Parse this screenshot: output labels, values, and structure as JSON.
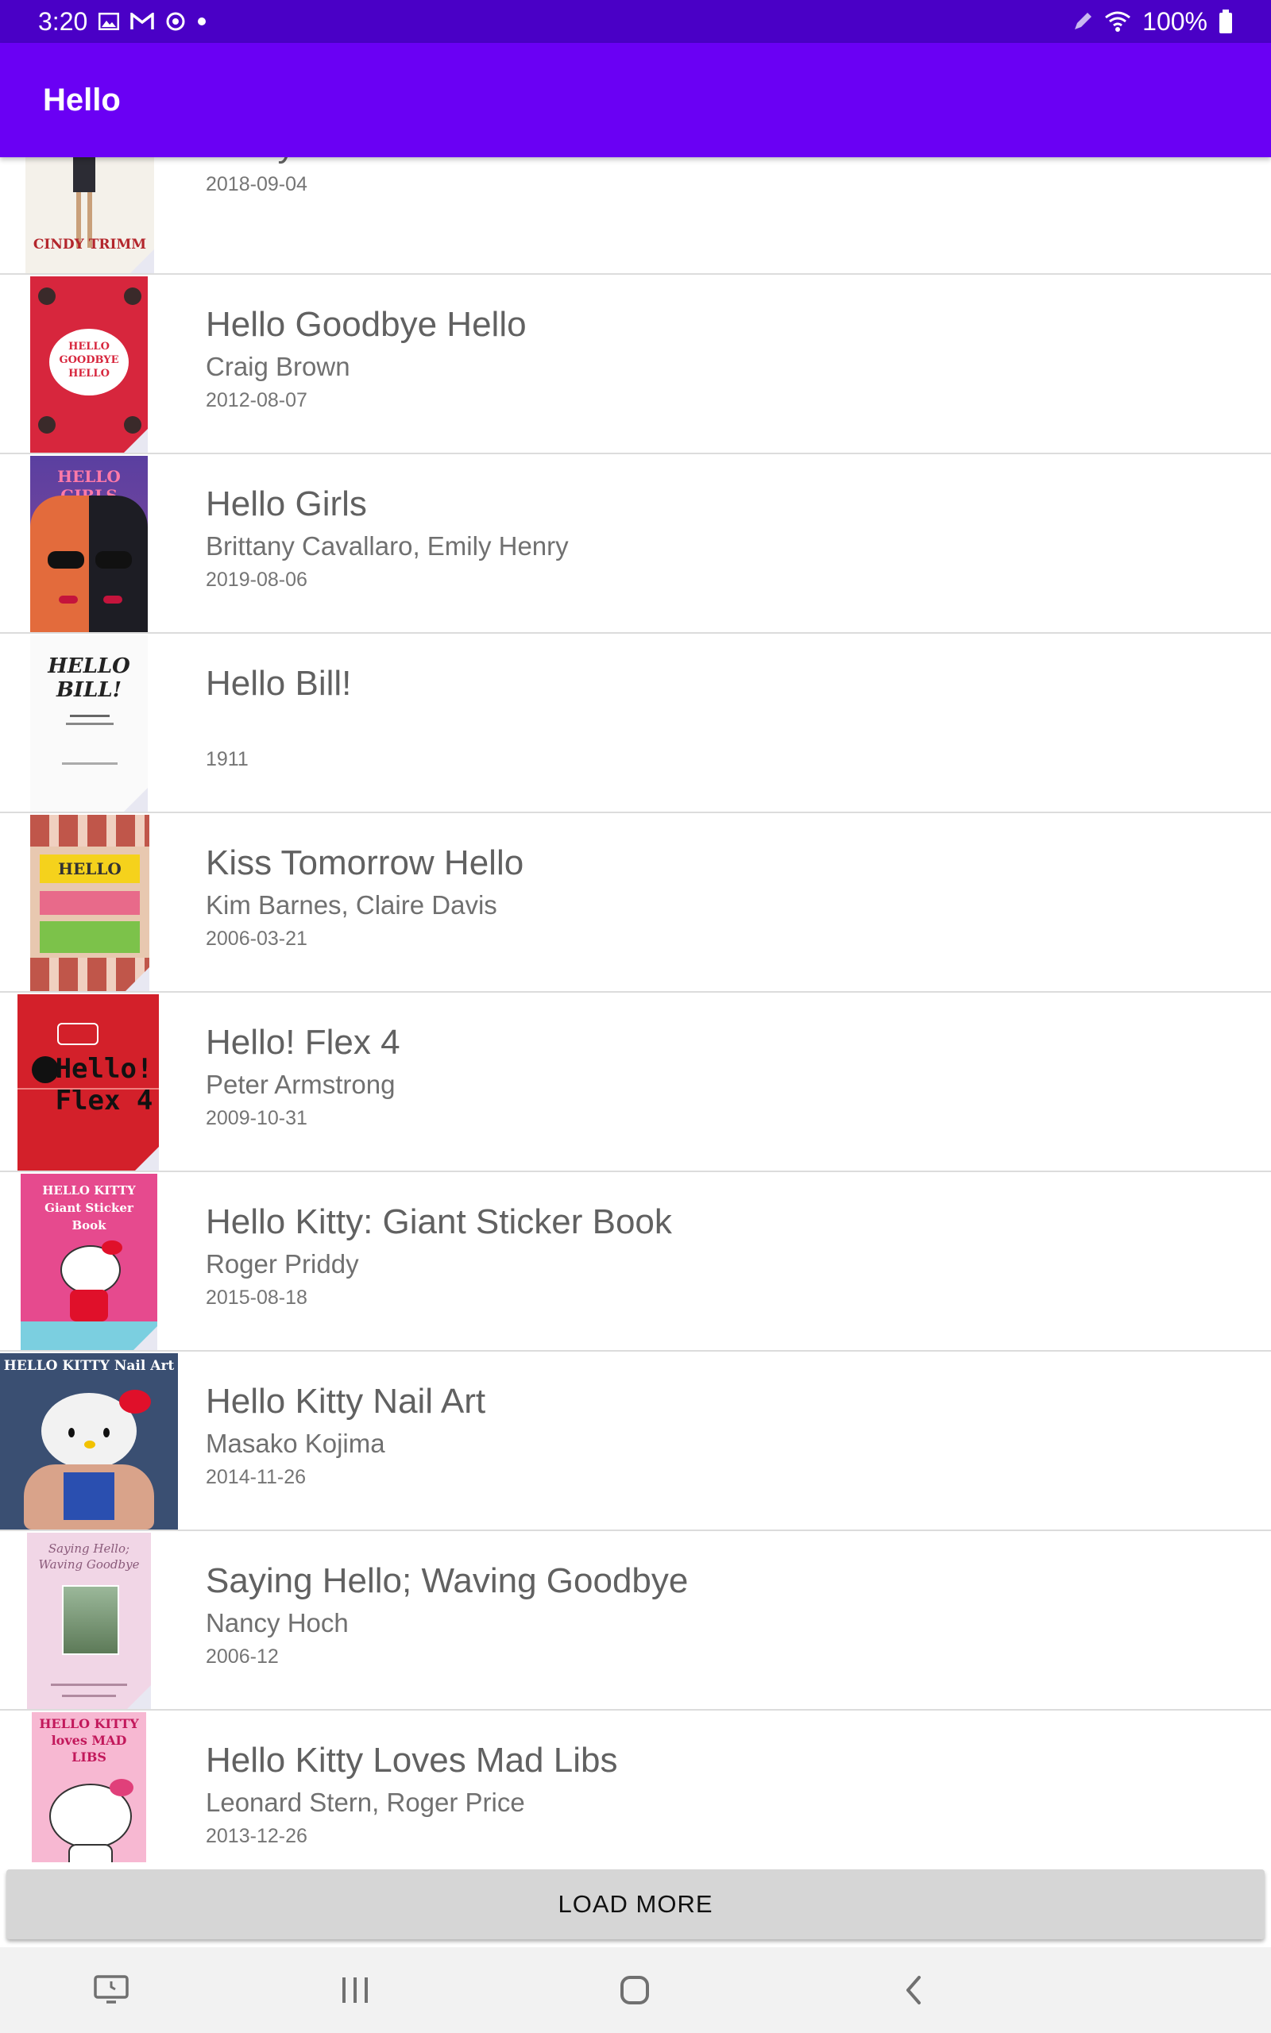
{
  "status_bar": {
    "time": "3:20",
    "battery": "100%",
    "left_icons": [
      "image-icon",
      "gmail-icon",
      "sync-icon",
      "dot-icon"
    ],
    "right_icons": [
      "pen-icon",
      "wifi-icon",
      "battery-icon"
    ]
  },
  "app_bar": {
    "title": "Hello"
  },
  "books": [
    {
      "title": "Cindy Trimm",
      "author": "",
      "date": "2018-09-04",
      "cover_text": "CINDY TRIMM"
    },
    {
      "title": "Hello Goodbye Hello",
      "author": "Craig Brown",
      "date": "2012-08-07",
      "cover_text": "HELLO GOODBYE HELLO"
    },
    {
      "title": "Hello Girls",
      "author": "Brittany Cavallaro, Emily Henry",
      "date": "2019-08-06",
      "cover_text": "HELLO GIRLS"
    },
    {
      "title": "Hello Bill!",
      "author": "",
      "date": "1911",
      "cover_text": "HELLO BILL!"
    },
    {
      "title": "Kiss Tomorrow Hello",
      "author": "Kim Barnes, Claire Davis",
      "date": "2006-03-21",
      "cover_text": "HELLO"
    },
    {
      "title": "Hello! Flex 4",
      "author": "Peter Armstrong",
      "date": "2009-10-31",
      "cover_text": "Hello! Flex 4"
    },
    {
      "title": "Hello Kitty: Giant Sticker Book",
      "author": "Roger Priddy",
      "date": "2015-08-18",
      "cover_text": "HELLO KITTY Giant Sticker Book"
    },
    {
      "title": "Hello Kitty Nail Art",
      "author": "Masako Kojima",
      "date": "2014-11-26",
      "cover_text": "HELLO KITTY Nail Art"
    },
    {
      "title": "Saying Hello; Waving Goodbye",
      "author": "Nancy Hoch",
      "date": "2006-12",
      "cover_text": "Saying Hello; Waving Goodbye"
    },
    {
      "title": "Hello Kitty Loves Mad Libs",
      "author": "Leonard Stern, Roger Price",
      "date": "2013-12-26",
      "cover_text": "HELLO KITTY loves MAD LIBS"
    }
  ],
  "load_more": {
    "label": "LOAD MORE"
  },
  "nav_bar": {
    "buttons": [
      "screenshot-icon",
      "recents-icon",
      "home-icon",
      "back-icon"
    ]
  },
  "colors": {
    "status_bar": "#4a00c6",
    "app_bar": "#6a00f4",
    "button": "#d6d6d6"
  }
}
